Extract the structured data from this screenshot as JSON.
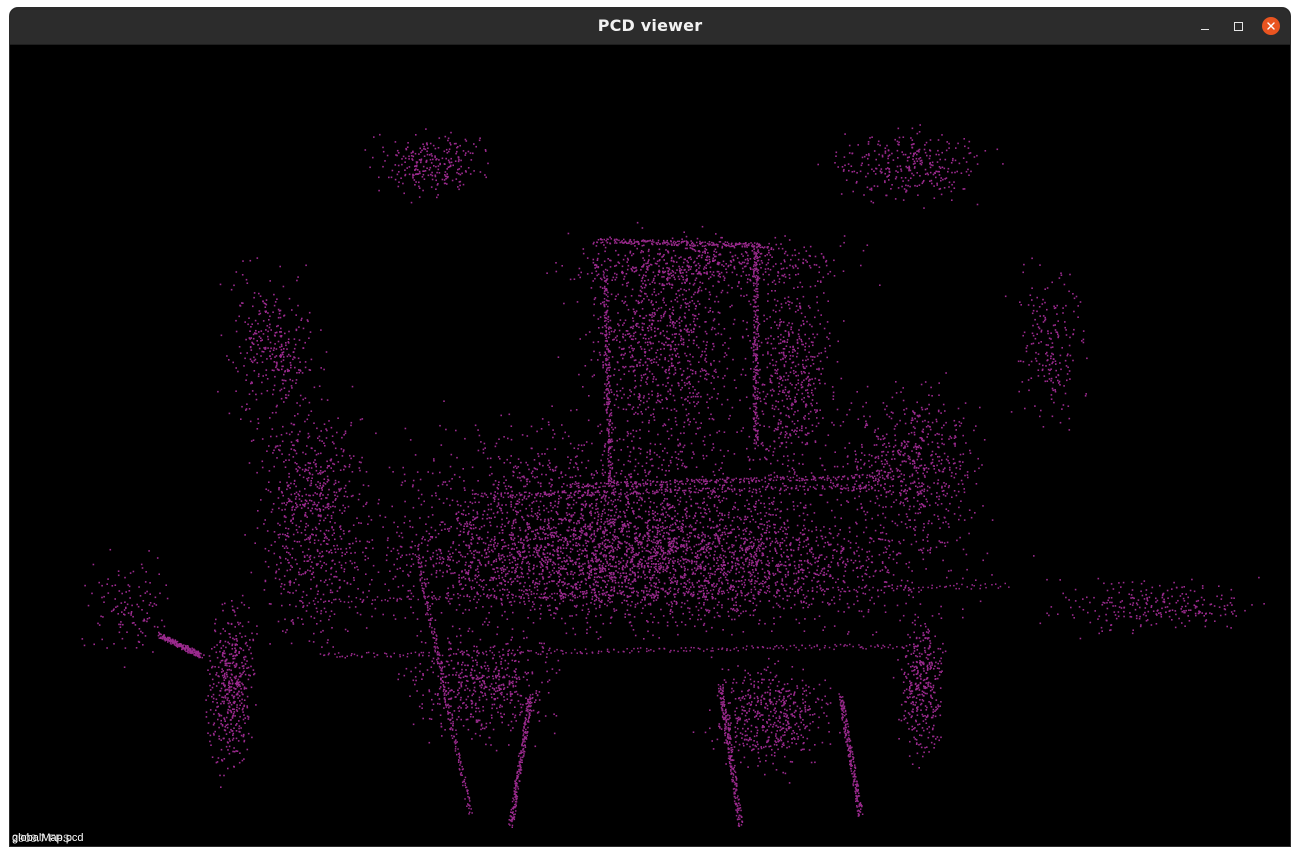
{
  "window": {
    "title": "PCD viewer",
    "controls": {
      "minimize_icon": "minimize-icon",
      "maximize_icon": "maximize-icon",
      "close_icon": "close-icon"
    }
  },
  "viewer": {
    "background_color": "#000000",
    "point_color": "#9b2a8e",
    "file_label": "globalMap.pcd",
    "fps_text": "2908.7 FPS"
  }
}
